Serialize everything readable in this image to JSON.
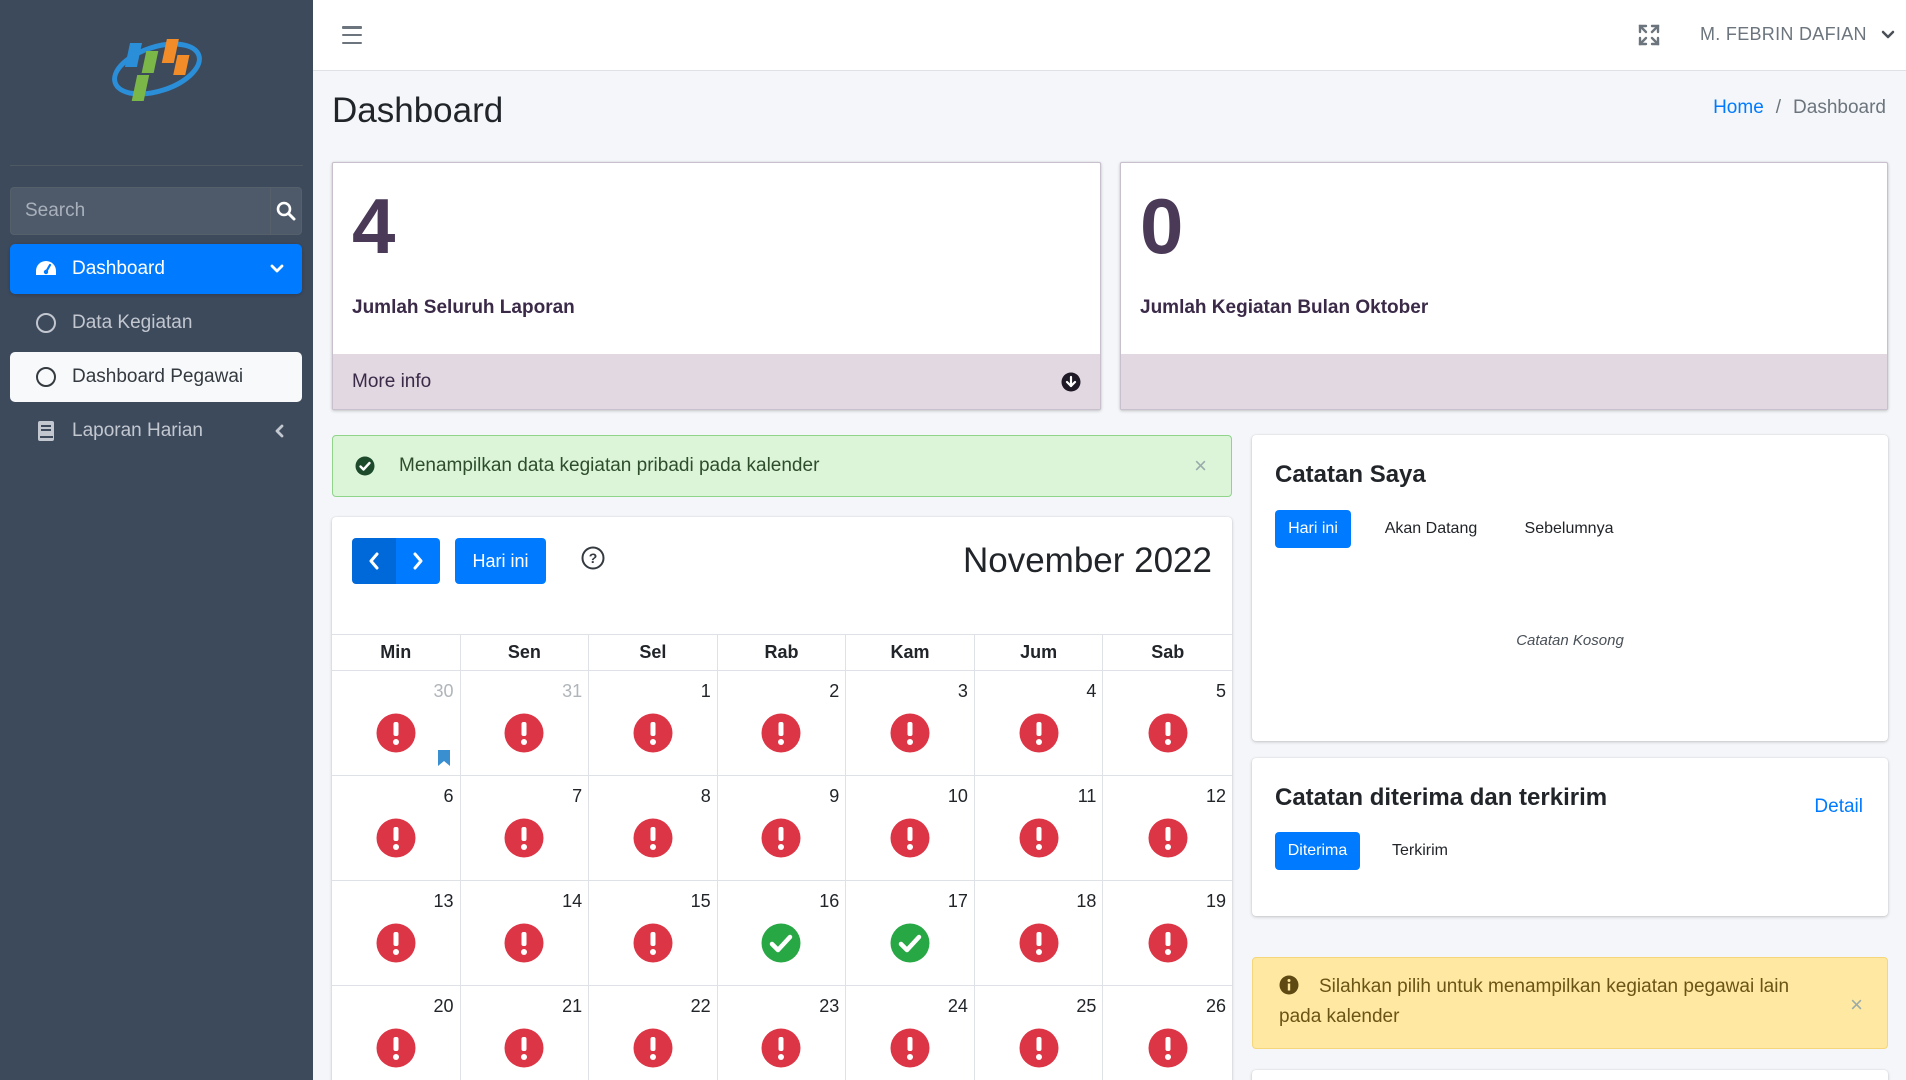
{
  "sidebar": {
    "search": {
      "placeholder": "Search"
    },
    "items": [
      {
        "label": "Dashboard",
        "icon": "tachometer-icon",
        "state": "active"
      },
      {
        "label": "Data Kegiatan",
        "icon": "circle-icon"
      },
      {
        "label": "Dashboard Pegawai",
        "icon": "circle-icon",
        "state": "selected"
      },
      {
        "label": "Laporan Harian",
        "icon": "book-icon"
      }
    ]
  },
  "topbar": {
    "user_name": "M. FEBRIN DAFIAN"
  },
  "header": {
    "title": "Dashboard",
    "breadcrumb": {
      "home": "Home",
      "sep": "/",
      "current": "Dashboard"
    }
  },
  "stats": [
    {
      "value": "4",
      "label": "Jumlah Seluruh Laporan",
      "footer": "More info"
    },
    {
      "value": "0",
      "label": "Jumlah Kegiatan Bulan Oktober",
      "footer": ""
    }
  ],
  "alert_success": {
    "text": "Menampilkan data kegiatan pribadi pada kalender",
    "close": "×"
  },
  "calendar": {
    "today_label": "Hari ini",
    "title": "November 2022",
    "weekdays": [
      "Min",
      "Sen",
      "Sel",
      "Rab",
      "Kam",
      "Jum",
      "Sab"
    ],
    "weeks": [
      [
        {
          "d": "30",
          "other": true,
          "s": "x",
          "bm": true
        },
        {
          "d": "31",
          "other": true,
          "s": "x"
        },
        {
          "d": "1",
          "s": "x"
        },
        {
          "d": "2",
          "s": "x"
        },
        {
          "d": "3",
          "s": "x"
        },
        {
          "d": "4",
          "s": "x"
        },
        {
          "d": "5",
          "s": "x"
        }
      ],
      [
        {
          "d": "6",
          "s": "x"
        },
        {
          "d": "7",
          "s": "x"
        },
        {
          "d": "8",
          "s": "x"
        },
        {
          "d": "9",
          "s": "x"
        },
        {
          "d": "10",
          "s": "x"
        },
        {
          "d": "11",
          "s": "x"
        },
        {
          "d": "12",
          "s": "x"
        }
      ],
      [
        {
          "d": "13",
          "s": "x"
        },
        {
          "d": "14",
          "s": "x"
        },
        {
          "d": "15",
          "s": "x"
        },
        {
          "d": "16",
          "s": "ok"
        },
        {
          "d": "17",
          "s": "ok"
        },
        {
          "d": "18",
          "s": "x"
        },
        {
          "d": "19",
          "s": "x"
        }
      ],
      [
        {
          "d": "20",
          "s": "x"
        },
        {
          "d": "21",
          "s": "x"
        },
        {
          "d": "22",
          "s": "x"
        },
        {
          "d": "23",
          "s": "x"
        },
        {
          "d": "24",
          "s": "x"
        },
        {
          "d": "25",
          "s": "x"
        },
        {
          "d": "26",
          "s": "x"
        }
      ]
    ]
  },
  "notes": {
    "title": "Catatan Saya",
    "tabs": [
      "Hari ini",
      "Akan Datang",
      "Sebelumnya"
    ],
    "empty": "Catatan Kosong"
  },
  "received": {
    "title": "Catatan diterima dan terkirim",
    "detail": "Detail",
    "tabs": [
      "Diterima",
      "Terkirim"
    ]
  },
  "alert_warn": {
    "text": "Silahkan pilih untuk menampilkan kegiatan pegawai lain pada kalender",
    "close": "×"
  },
  "colors": {
    "primary": "#007bff",
    "danger": "#dc3545",
    "success": "#28a745",
    "sidebar": "#3d4a5c"
  }
}
